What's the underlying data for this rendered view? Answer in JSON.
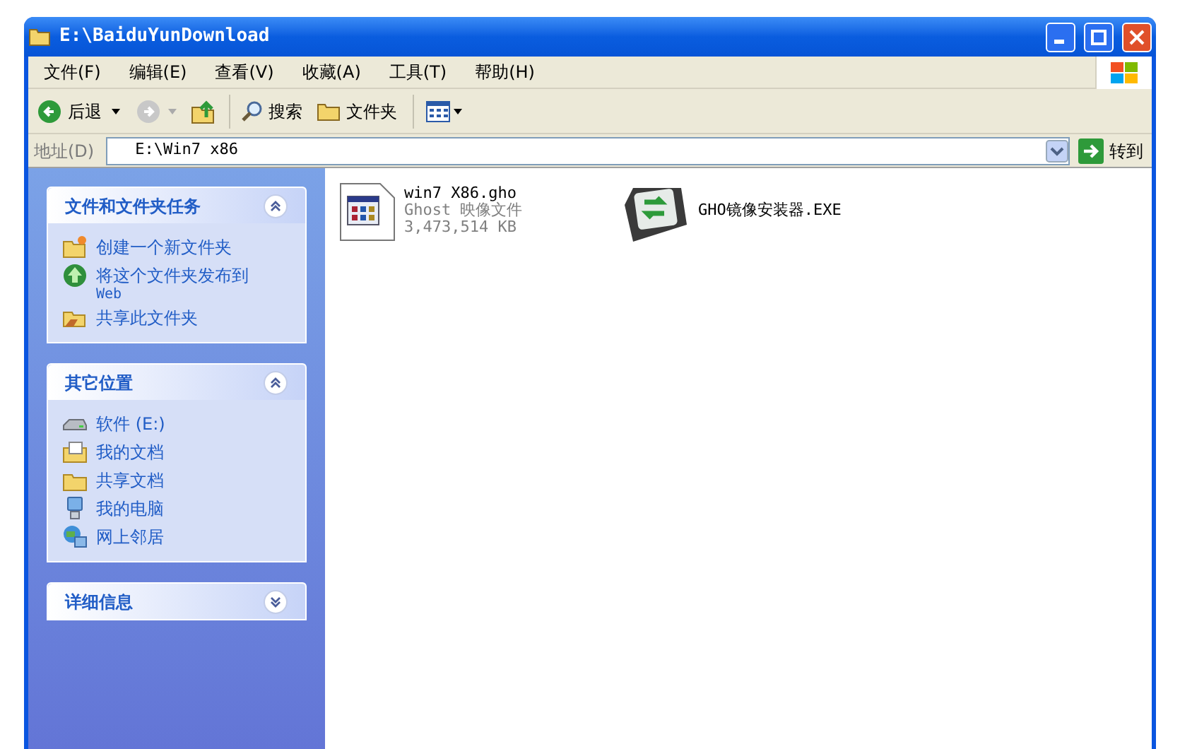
{
  "window": {
    "title": "E:\\BaiduYunDownload"
  },
  "menu": [
    "文件(F)",
    "编辑(E)",
    "查看(V)",
    "收藏(A)",
    "工具(T)",
    "帮助(H)"
  ],
  "toolbar": {
    "back": "后退",
    "search": "搜索",
    "folders": "文件夹"
  },
  "address": {
    "label": "地址(D)",
    "value": "E:\\Win7 x86",
    "go": "转到"
  },
  "sidebar": [
    {
      "title": "文件和文件夹任务",
      "expanded": true,
      "items": [
        {
          "kind": "new-folder",
          "label": "创建一个新文件夹"
        },
        {
          "kind": "publish",
          "label": "将这个文件夹发布到",
          "sub": "Web"
        },
        {
          "kind": "share",
          "label": "共享此文件夹"
        }
      ]
    },
    {
      "title": "其它位置",
      "expanded": true,
      "items": [
        {
          "kind": "drive",
          "label": "软件 (E:)"
        },
        {
          "kind": "documents",
          "label": "我的文档"
        },
        {
          "kind": "folder",
          "label": "共享文档"
        },
        {
          "kind": "computer",
          "label": "我的电脑"
        },
        {
          "kind": "network",
          "label": "网上邻居"
        }
      ]
    },
    {
      "title": "详细信息",
      "expanded": false
    }
  ],
  "files": [
    {
      "kind": "gho",
      "name": "win7 X86.gho",
      "type": "Ghost 映像文件",
      "size": "3,473,514 KB"
    },
    {
      "kind": "exe",
      "name": "GHO镜像安装器.EXE"
    }
  ]
}
